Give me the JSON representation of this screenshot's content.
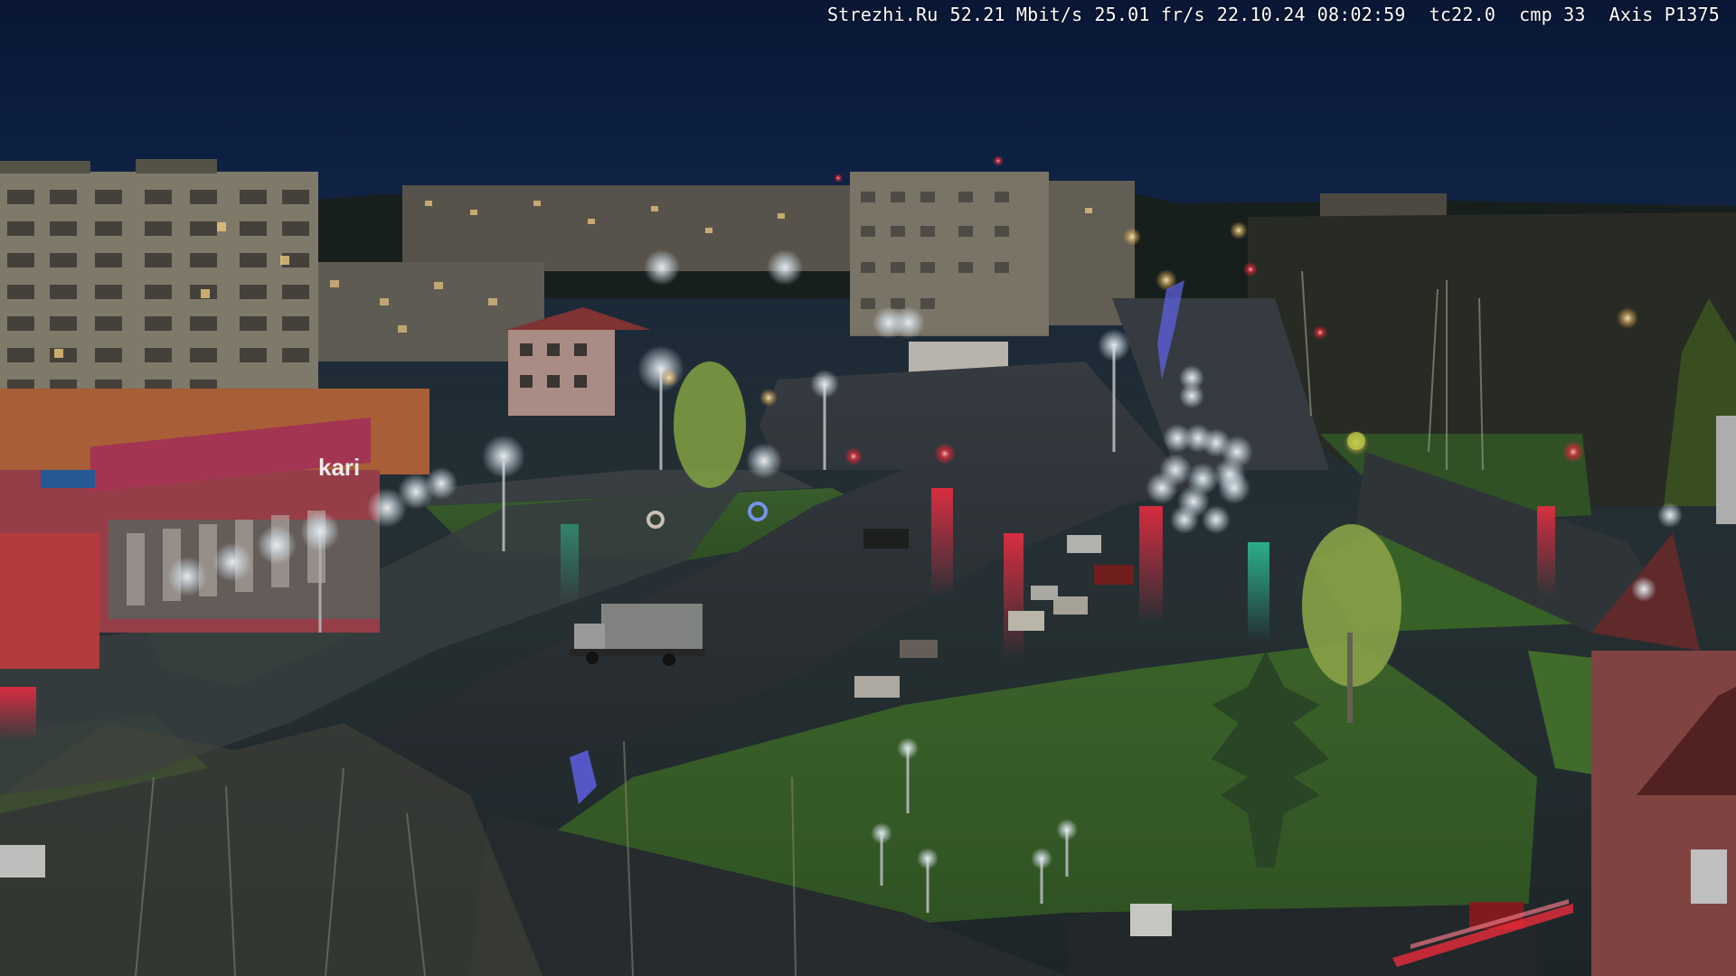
{
  "camera_overlay": {
    "site": "Strezhi.Ru",
    "bitrate": "52.21 Mbit/s",
    "framerate": "25.01 fr/s",
    "date": "22.10.24",
    "time": "08:02:59",
    "tc": "tc22.0",
    "cmp": "cmp 33",
    "camera_model": "Axis P1375"
  },
  "scene": {
    "store_sign": "kari",
    "palette": {
      "sky": "#0f2246",
      "building": "#7a7465",
      "grass": "#3f6b2c",
      "road": "#2b3134",
      "streetlight": "#f4fbff",
      "traffic_red": "#ff2a3a",
      "store_facade": "#a2444e"
    }
  }
}
